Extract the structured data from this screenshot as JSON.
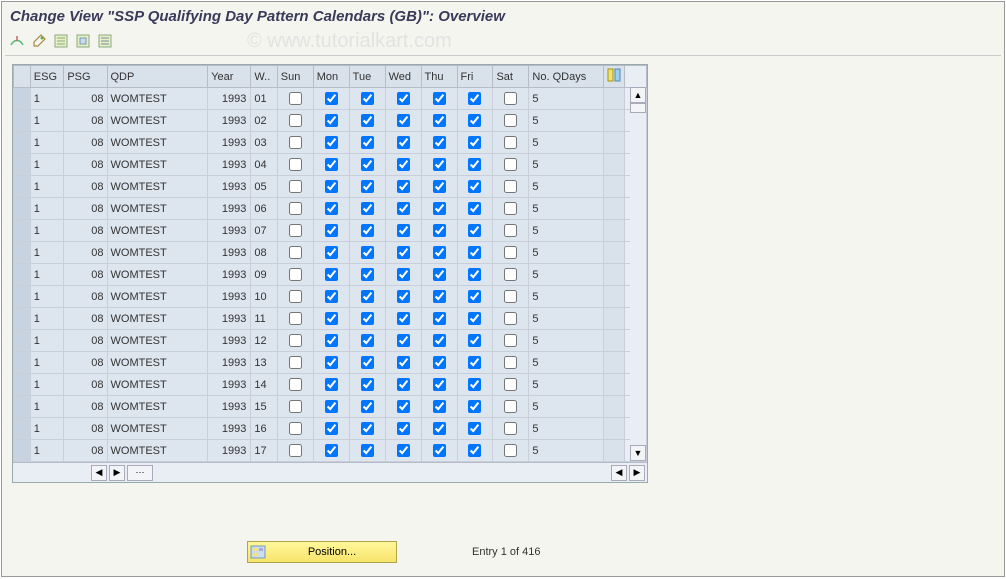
{
  "title": "Change View \"SSP Qualifying Day Pattern Calendars (GB)\": Overview",
  "watermark": "© www.tutorialkart.com",
  "toolbar": {
    "icons": [
      "other-view",
      "toggle-change",
      "new-entries",
      "copy",
      "delete"
    ]
  },
  "columns": {
    "esg": "ESG",
    "psg": "PSG",
    "qdp": "QDP",
    "year": "Year",
    "wk": "W..",
    "sun": "Sun",
    "mon": "Mon",
    "tue": "Tue",
    "wed": "Wed",
    "thu": "Thu",
    "fri": "Fri",
    "sat": "Sat",
    "no": "No. QDays"
  },
  "rows": [
    {
      "esg": "1",
      "psg": "08",
      "qdp": "WOMTEST",
      "year": "1993",
      "wk": "01",
      "sun": false,
      "mon": true,
      "tue": true,
      "wed": true,
      "thu": true,
      "fri": true,
      "sat": false,
      "no": "5"
    },
    {
      "esg": "1",
      "psg": "08",
      "qdp": "WOMTEST",
      "year": "1993",
      "wk": "02",
      "sun": false,
      "mon": true,
      "tue": true,
      "wed": true,
      "thu": true,
      "fri": true,
      "sat": false,
      "no": "5"
    },
    {
      "esg": "1",
      "psg": "08",
      "qdp": "WOMTEST",
      "year": "1993",
      "wk": "03",
      "sun": false,
      "mon": true,
      "tue": true,
      "wed": true,
      "thu": true,
      "fri": true,
      "sat": false,
      "no": "5"
    },
    {
      "esg": "1",
      "psg": "08",
      "qdp": "WOMTEST",
      "year": "1993",
      "wk": "04",
      "sun": false,
      "mon": true,
      "tue": true,
      "wed": true,
      "thu": true,
      "fri": true,
      "sat": false,
      "no": "5"
    },
    {
      "esg": "1",
      "psg": "08",
      "qdp": "WOMTEST",
      "year": "1993",
      "wk": "05",
      "sun": false,
      "mon": true,
      "tue": true,
      "wed": true,
      "thu": true,
      "fri": true,
      "sat": false,
      "no": "5"
    },
    {
      "esg": "1",
      "psg": "08",
      "qdp": "WOMTEST",
      "year": "1993",
      "wk": "06",
      "sun": false,
      "mon": true,
      "tue": true,
      "wed": true,
      "thu": true,
      "fri": true,
      "sat": false,
      "no": "5"
    },
    {
      "esg": "1",
      "psg": "08",
      "qdp": "WOMTEST",
      "year": "1993",
      "wk": "07",
      "sun": false,
      "mon": true,
      "tue": true,
      "wed": true,
      "thu": true,
      "fri": true,
      "sat": false,
      "no": "5"
    },
    {
      "esg": "1",
      "psg": "08",
      "qdp": "WOMTEST",
      "year": "1993",
      "wk": "08",
      "sun": false,
      "mon": true,
      "tue": true,
      "wed": true,
      "thu": true,
      "fri": true,
      "sat": false,
      "no": "5"
    },
    {
      "esg": "1",
      "psg": "08",
      "qdp": "WOMTEST",
      "year": "1993",
      "wk": "09",
      "sun": false,
      "mon": true,
      "tue": true,
      "wed": true,
      "thu": true,
      "fri": true,
      "sat": false,
      "no": "5"
    },
    {
      "esg": "1",
      "psg": "08",
      "qdp": "WOMTEST",
      "year": "1993",
      "wk": "10",
      "sun": false,
      "mon": true,
      "tue": true,
      "wed": true,
      "thu": true,
      "fri": true,
      "sat": false,
      "no": "5"
    },
    {
      "esg": "1",
      "psg": "08",
      "qdp": "WOMTEST",
      "year": "1993",
      "wk": "11",
      "sun": false,
      "mon": true,
      "tue": true,
      "wed": true,
      "thu": true,
      "fri": true,
      "sat": false,
      "no": "5"
    },
    {
      "esg": "1",
      "psg": "08",
      "qdp": "WOMTEST",
      "year": "1993",
      "wk": "12",
      "sun": false,
      "mon": true,
      "tue": true,
      "wed": true,
      "thu": true,
      "fri": true,
      "sat": false,
      "no": "5"
    },
    {
      "esg": "1",
      "psg": "08",
      "qdp": "WOMTEST",
      "year": "1993",
      "wk": "13",
      "sun": false,
      "mon": true,
      "tue": true,
      "wed": true,
      "thu": true,
      "fri": true,
      "sat": false,
      "no": "5"
    },
    {
      "esg": "1",
      "psg": "08",
      "qdp": "WOMTEST",
      "year": "1993",
      "wk": "14",
      "sun": false,
      "mon": true,
      "tue": true,
      "wed": true,
      "thu": true,
      "fri": true,
      "sat": false,
      "no": "5"
    },
    {
      "esg": "1",
      "psg": "08",
      "qdp": "WOMTEST",
      "year": "1993",
      "wk": "15",
      "sun": false,
      "mon": true,
      "tue": true,
      "wed": true,
      "thu": true,
      "fri": true,
      "sat": false,
      "no": "5"
    },
    {
      "esg": "1",
      "psg": "08",
      "qdp": "WOMTEST",
      "year": "1993",
      "wk": "16",
      "sun": false,
      "mon": true,
      "tue": true,
      "wed": true,
      "thu": true,
      "fri": true,
      "sat": false,
      "no": "5"
    },
    {
      "esg": "1",
      "psg": "08",
      "qdp": "WOMTEST",
      "year": "1993",
      "wk": "17",
      "sun": false,
      "mon": true,
      "tue": true,
      "wed": true,
      "thu": true,
      "fri": true,
      "sat": false,
      "no": "5"
    }
  ],
  "footer": {
    "position_label": "Position...",
    "entry_text": "Entry 1 of 416"
  }
}
